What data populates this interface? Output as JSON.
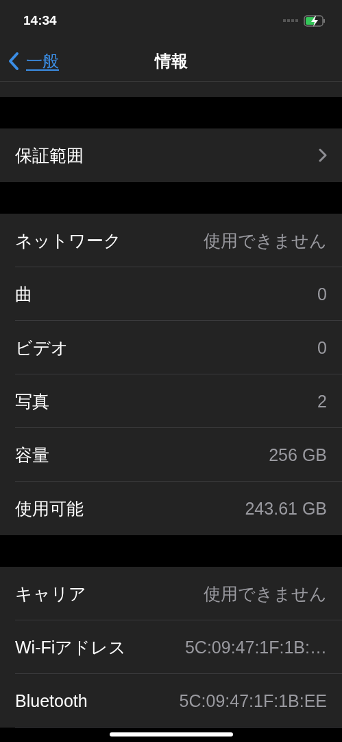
{
  "status_bar": {
    "time": "14:34"
  },
  "nav": {
    "back_label": "一般",
    "title": "情報"
  },
  "groups": [
    {
      "rows": [
        {
          "kind": "disclosure",
          "label": "保証範囲"
        }
      ]
    },
    {
      "rows": [
        {
          "kind": "value",
          "label": "ネットワーク",
          "value": "使用できません"
        },
        {
          "kind": "value",
          "label": "曲",
          "value": "0"
        },
        {
          "kind": "value",
          "label": "ビデオ",
          "value": "0"
        },
        {
          "kind": "value",
          "label": "写真",
          "value": "2"
        },
        {
          "kind": "value",
          "label": "容量",
          "value": "256 GB"
        },
        {
          "kind": "value",
          "label": "使用可能",
          "value": "243.61 GB"
        }
      ]
    },
    {
      "rows": [
        {
          "kind": "value",
          "label": "キャリア",
          "value": "使用できません"
        },
        {
          "kind": "value",
          "label": "Wi-Fiアドレス",
          "value": "5C:09:47:1F:1B:…"
        },
        {
          "kind": "value",
          "label": "Bluetooth",
          "value": "5C:09:47:1F:1B:EE"
        }
      ]
    }
  ]
}
